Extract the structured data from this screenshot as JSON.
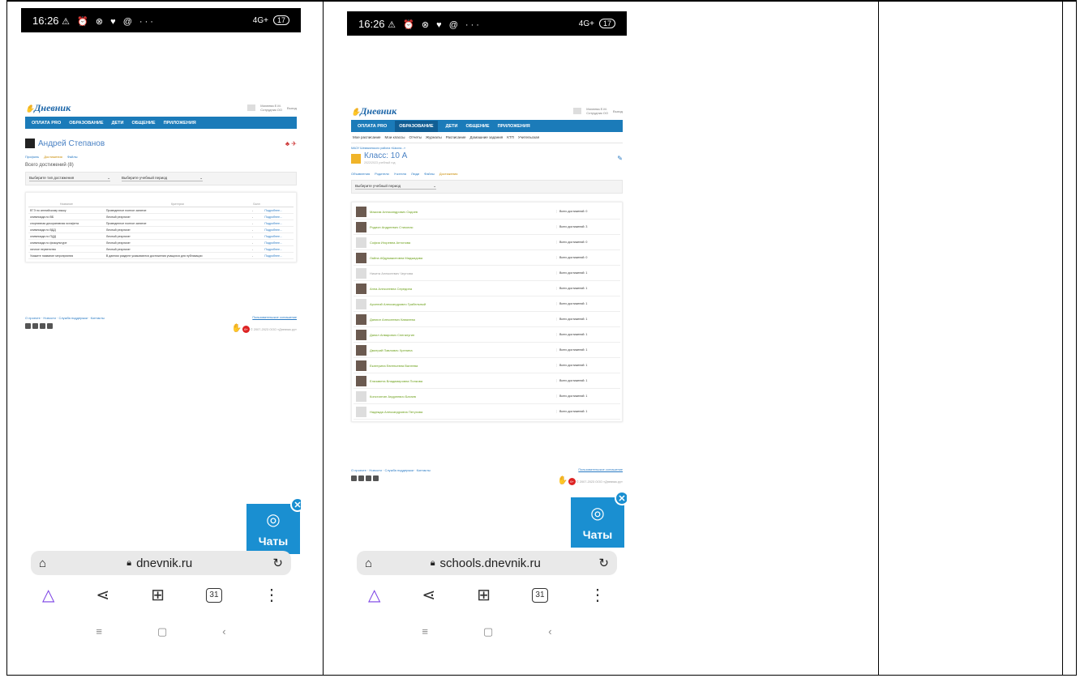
{
  "status_bar": {
    "time": "16:26",
    "icons": "⚠ ⏰ ⊗ ♥ @ ···",
    "signal": "4G+",
    "battery": "17"
  },
  "site": {
    "logo": "Дневник",
    "user_name_1": "Михеева Е.М.",
    "user_role_1": "Сотрудник ОО",
    "user_name_2": "Михеева Е.М.",
    "user_role_2": "Сотрудник ОО",
    "logout": "Выход",
    "nav": [
      "ОПЛАТА PRO",
      "ОБРАЗОВАНИЕ",
      "ДЕТИ",
      "ОБЩЕНИЕ",
      "ПРИЛОЖЕНИЯ"
    ]
  },
  "left": {
    "person_name": "Андрей Степанов",
    "tabs": [
      "Профиль",
      "Достижения",
      "Файлы"
    ],
    "total": "Всего достижений (8)",
    "filter_type": "Выберите тип достижения",
    "filter_period": "Выберите учебный период",
    "columns": [
      "Название",
      "Критерии",
      "Балл",
      ""
    ],
    "rows": [
      [
        "ЕГЭ по английскому языку",
        "Проведенное полное занятие",
        "-",
        "Подробнее..."
      ],
      [
        "олимпиада по ВБ",
        "Личный результат",
        "-",
        "Подробнее..."
      ],
      [
        "спортивная декоративная эстафета",
        "Проведенное полное занятие",
        "-",
        "Подробнее..."
      ],
      [
        "олимпиада по ВДД",
        "Личный результат",
        "-",
        "Подробнее..."
      ],
      [
        "олимпиада по ПДД",
        "Личный результат",
        "-",
        "Подробнее..."
      ],
      [
        "олимпиада по физкультуре",
        "Личный результат",
        "-",
        "Подробнее..."
      ],
      [
        "личное первенство",
        "Личный результат",
        "-",
        "Подробнее..."
      ],
      [
        "Укажите название мероприятия",
        "В данном разделе указываются достижения учащихся для публикации",
        "-",
        "Подробнее..."
      ]
    ],
    "footer_links": "О проекте · Новости · Служба поддержки · Контакты",
    "footer_right_link": "Пользовательское соглашение",
    "copyright": "© 2007-2023 ООО «Дневник.ру»",
    "age": "6+"
  },
  "right": {
    "subnav": [
      "Мое расписание",
      "Мои классы",
      "Отчеты",
      "Журналы",
      "Расписание",
      "Домашние задания",
      "КТП",
      "Учительская"
    ],
    "breadcrumb": "МАОУ Шемякинского района «Школа...»",
    "class_name": "Класс: 10 А",
    "class_sub": "2022/2023 учебный год",
    "tabs": [
      "Объявления",
      "Родители",
      "Учителя",
      "Люди",
      "Файлы",
      "Достижения"
    ],
    "filter_period": "Выберите учебный период",
    "students": [
      {
        "name": "Максим Александрович Оздоев",
        "count": "Всего достижений: 0",
        "photo": "dark"
      },
      {
        "name": "Родион Андреевич Стикопас",
        "count": "Всего достижений: 3",
        "photo": "dark"
      },
      {
        "name": "София Игоревна Антонова",
        "count": "Всего достижений: 0",
        "photo": ""
      },
      {
        "name": "Лайла Абдумажитовна Маджидова",
        "count": "Всего достижений: 0",
        "photo": "dark"
      },
      {
        "name": "Никита Алексеевич Чернова",
        "count": "Всего достижений: 1",
        "photo": "",
        "grey": true
      },
      {
        "name": "Анна Алексеевна Середина",
        "count": "Всего достижений: 1",
        "photo": "dark"
      },
      {
        "name": "Арсений Александрович Грабельный",
        "count": "Всего достижений: 1",
        "photo": ""
      },
      {
        "name": "Даниил Алексеевич Кавалева",
        "count": "Всего достижений: 1",
        "photo": "dark"
      },
      {
        "name": "Данил Анварович Снегалугин",
        "count": "Всего достижений: 1",
        "photo": "dark"
      },
      {
        "name": "Дмитрий Павлович Хренина",
        "count": "Всего достижений: 1",
        "photo": "dark"
      },
      {
        "name": "Екатерина Евгеньевна Валеева",
        "count": "Всего достижений: 1",
        "photo": "dark"
      },
      {
        "name": "Елизавета Владимировна Попкова",
        "count": "Всего достижений: 1",
        "photo": "dark"
      },
      {
        "name": "Константин Андреевич Батаев",
        "count": "Всего достижений: 1",
        "photo": ""
      },
      {
        "name": "Надежда Александровна Петухова",
        "count": "Всего достижений: 1",
        "photo": ""
      }
    ],
    "footer_links": "О проекте · Новости · Служба поддержки · Контакты",
    "footer_right_link": "Пользовательское соглашение",
    "copyright": "© 2007-2023 ООО «Дневник.ру»",
    "age": "6+"
  },
  "chats_label": "Чаты",
  "left_url": "dnevnik.ru",
  "right_url": "schools.dnevnik.ru",
  "tab_count": "31"
}
